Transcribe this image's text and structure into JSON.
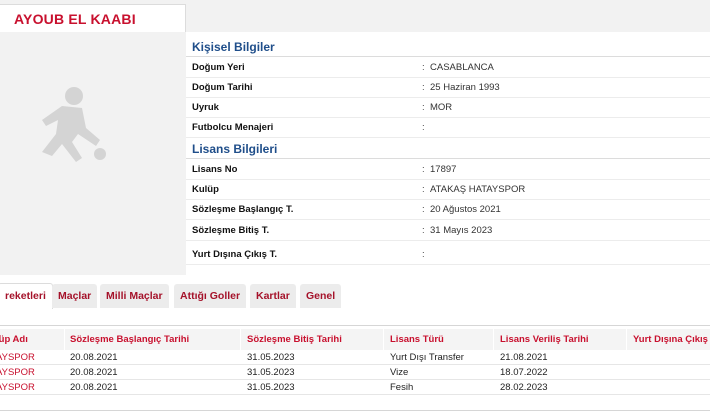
{
  "player": {
    "name": "AYOUB EL KAABI"
  },
  "personal": {
    "title": "Kişisel Bilgiler",
    "rows": [
      {
        "label": "Doğum Yeri",
        "value": "CASABLANCA"
      },
      {
        "label": "Doğum Tarihi",
        "value": "25 Haziran 1993"
      },
      {
        "label": "Uyruk",
        "value": "MOR"
      },
      {
        "label": "Futbolcu Menajeri",
        "value": ""
      }
    ]
  },
  "license": {
    "title": "Lisans Bilgileri",
    "rows": [
      {
        "label": "Lisans No",
        "value": "17897"
      },
      {
        "label": "Kulüp",
        "value": "ATAKAŞ HATAYSPOR"
      },
      {
        "label": "Sözleşme Başlangıç T.",
        "value": "20 Ağustos 2021"
      },
      {
        "label": "Sözleşme Bitiş T.",
        "value": "31 Mayıs 2023"
      },
      {
        "label": "Yurt Dışına Çıkış T.",
        "value": ""
      }
    ]
  },
  "colon": ":",
  "tabs": [
    {
      "label": "reketleri",
      "active": true
    },
    {
      "label": "Maçlar"
    },
    {
      "label": "Milli Maçlar"
    },
    {
      "label": "Attığı Goller"
    },
    {
      "label": "Kartlar"
    },
    {
      "label": "Genel"
    }
  ],
  "table": {
    "headers": [
      "lüp Adı",
      "Sözleşme Başlangıç Tarihi",
      "Sözleşme Bitiş Tarihi",
      "Lisans Türü",
      "Lisans Veriliş Tarihi",
      "Yurt Dışına Çıkış Tarihi"
    ],
    "rows": [
      [
        "AYSPOR",
        "20.08.2021",
        "31.05.2023",
        "Yurt Dışı Transfer",
        "21.08.2021",
        ""
      ],
      [
        "AYSPOR",
        "20.08.2021",
        "31.05.2023",
        "Vize",
        "18.07.2022",
        ""
      ],
      [
        "AYSPOR",
        "20.08.2021",
        "31.05.2023",
        "Fesih",
        "28.02.2023",
        ""
      ]
    ]
  },
  "colors": {
    "accent": "#c8102e",
    "section_title": "#1f4e8a",
    "panel_bg": "#f2f2f2"
  }
}
